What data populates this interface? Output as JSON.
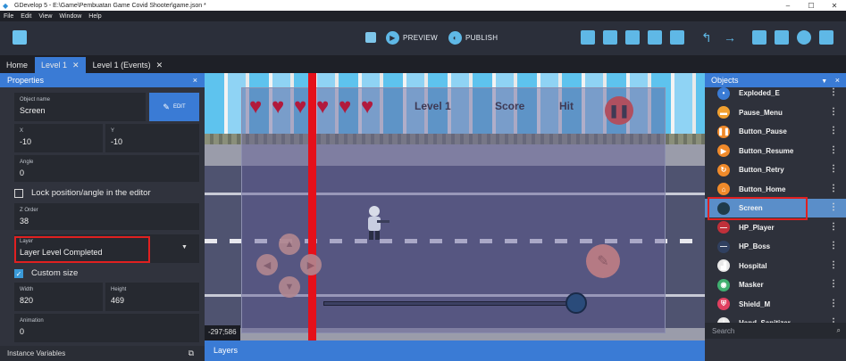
{
  "titlebar": {
    "title": "GDevelop 5 - E:\\Game\\Pembuatan Game Covid Shooter\\game.json *",
    "min": "–",
    "max": "☐",
    "close": "✕"
  },
  "menu": [
    "File",
    "Edit",
    "View",
    "Window",
    "Help"
  ],
  "toolbar": {
    "preview": "PREVIEW",
    "publish": "PUBLISH",
    "accent": "#5fb8e6"
  },
  "tabs": [
    {
      "label": "Home",
      "close": ""
    },
    {
      "label": "Level 1",
      "close": "✕"
    },
    {
      "label": "Level 1 (Events)",
      "close": "✕"
    }
  ],
  "properties": {
    "title": "Properties",
    "close": "×",
    "object_name_label": "Object name",
    "object_name": "Screen",
    "edit": "EDIT",
    "x_label": "X",
    "x": "-10",
    "y_label": "Y",
    "y": "-10",
    "angle_label": "Angle",
    "angle": "0",
    "lock_label": "Lock position/angle in the editor",
    "z_label": "Z Order",
    "z": "38",
    "layer_label": "Layer",
    "layer": "Layer Level Completed",
    "custom_size_label": "Custom size",
    "width_label": "Width",
    "width": "820",
    "height_label": "Height",
    "height": "469",
    "animation_label": "Animation",
    "animation": "0",
    "instance_vars": "Instance Variables",
    "ext": "⧉"
  },
  "scene": {
    "hud_level": "Level 1",
    "hud_score": "Score",
    "hud_hit": "Hit",
    "heart": "♥",
    "pause": "❚❚",
    "arrow_up": "▲",
    "arrow_left": "◀",
    "arrow_right": "▶",
    "arrow_down": "▼",
    "shoot": "✎",
    "coords": "-297;586"
  },
  "layers_label": "Layers",
  "objects": {
    "title": "Objects",
    "filter": "▼",
    "close": "×",
    "search_placeholder": "Search",
    "search_icon": "⌕",
    "items": [
      {
        "name": "Exploded_E",
        "icon": "star-icon",
        "color": "#3a7bd5",
        "glyph": "•"
      },
      {
        "name": "Pause_Menu",
        "icon": "panel-icon",
        "color": "#f0a030",
        "glyph": "▬"
      },
      {
        "name": "Button_Pause",
        "icon": "pause-icon",
        "color": "#f08a2a",
        "glyph": "❚❚"
      },
      {
        "name": "Button_Resume",
        "icon": "play-icon",
        "color": "#f08a2a",
        "glyph": "▶"
      },
      {
        "name": "Button_Retry",
        "icon": "retry-icon",
        "color": "#f08a2a",
        "glyph": "↻"
      },
      {
        "name": "Button_Home",
        "icon": "home-icon",
        "color": "#f08a2a",
        "glyph": "⌂"
      },
      {
        "name": "Screen",
        "icon": "screen-icon",
        "color": "#1f3b4a",
        "glyph": ""
      },
      {
        "name": "HP_Player",
        "icon": "bar-icon",
        "color": "#c0303a",
        "glyph": "—"
      },
      {
        "name": "HP_Boss",
        "icon": "bar-icon",
        "color": "#304060",
        "glyph": "—"
      },
      {
        "name": "Hospital",
        "icon": "hospital-icon",
        "color": "#e8e8e8",
        "glyph": "▟"
      },
      {
        "name": "Masker",
        "icon": "mask-icon",
        "color": "#40b070",
        "glyph": "◉"
      },
      {
        "name": "Shield_M",
        "icon": "shield-icon",
        "color": "#e04060",
        "glyph": "⛨"
      },
      {
        "name": "Hand_Sanitizer",
        "icon": "bottle-icon",
        "color": "#e8e8e8",
        "glyph": "⏚"
      }
    ]
  }
}
